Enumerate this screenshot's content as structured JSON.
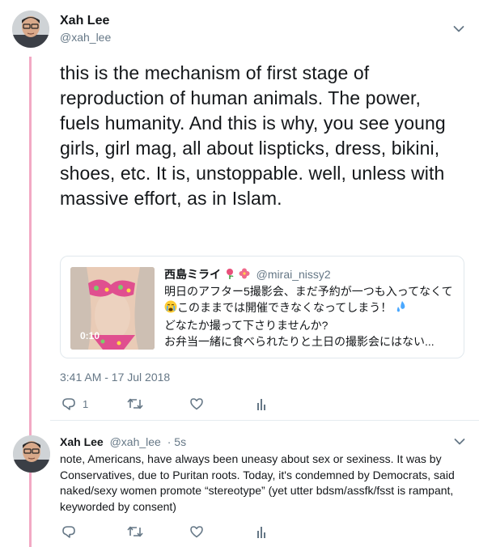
{
  "main_tweet": {
    "author_name": "Xah Lee",
    "author_handle": "@xah_lee",
    "text": "this is the mechanism of first stage of reproduction of human animals. The power, fuels humanity. And this is why, you see young girls, girl mag, all about lispticks, dress, bikini, shoes, etc. It is, unstoppable. well, unless with massive effort, as in Islam.",
    "timestamp": "3:41 AM - 17 Jul 2018",
    "reply_count": "1",
    "retweet_count": "",
    "like_count": ""
  },
  "quoted_tweet": {
    "author_name": "西島ミライ",
    "author_handle": "@mirai_nissy2",
    "lines": [
      "明日のアフター5撮影会、まだ予約が一つも入ってなくて",
      "このままでは開催できなくなってしまう！",
      "どなたか撮って下さりませんか?",
      "お弁当一緒に食べられたりと土日の撮影会にはない..."
    ],
    "video_duration": "0:10",
    "emoji_icons": [
      "rose-icon",
      "hibiscus-icon",
      "crying-face-icon",
      "sweat-drops-icon"
    ]
  },
  "reply_tweet": {
    "author_name": "Xah Lee",
    "author_handle": "@xah_lee",
    "time_ago": "· 5s",
    "lines": [
      "note, Americans, have always been uneasy about sex or sexiness. It was by",
      "Conservatives, due to Puritan roots. Today, it's condemned by Democrats, said",
      "naked/sexy women promote “stereotype” (yet utter bdsm/assfk/fsst is rampant,",
      "keyworded by consent)"
    ]
  },
  "colors": {
    "thread_line": "#f2a9c4",
    "secondary_text": "#657786",
    "primary_text": "#14171a",
    "border": "#e1e8ed"
  }
}
